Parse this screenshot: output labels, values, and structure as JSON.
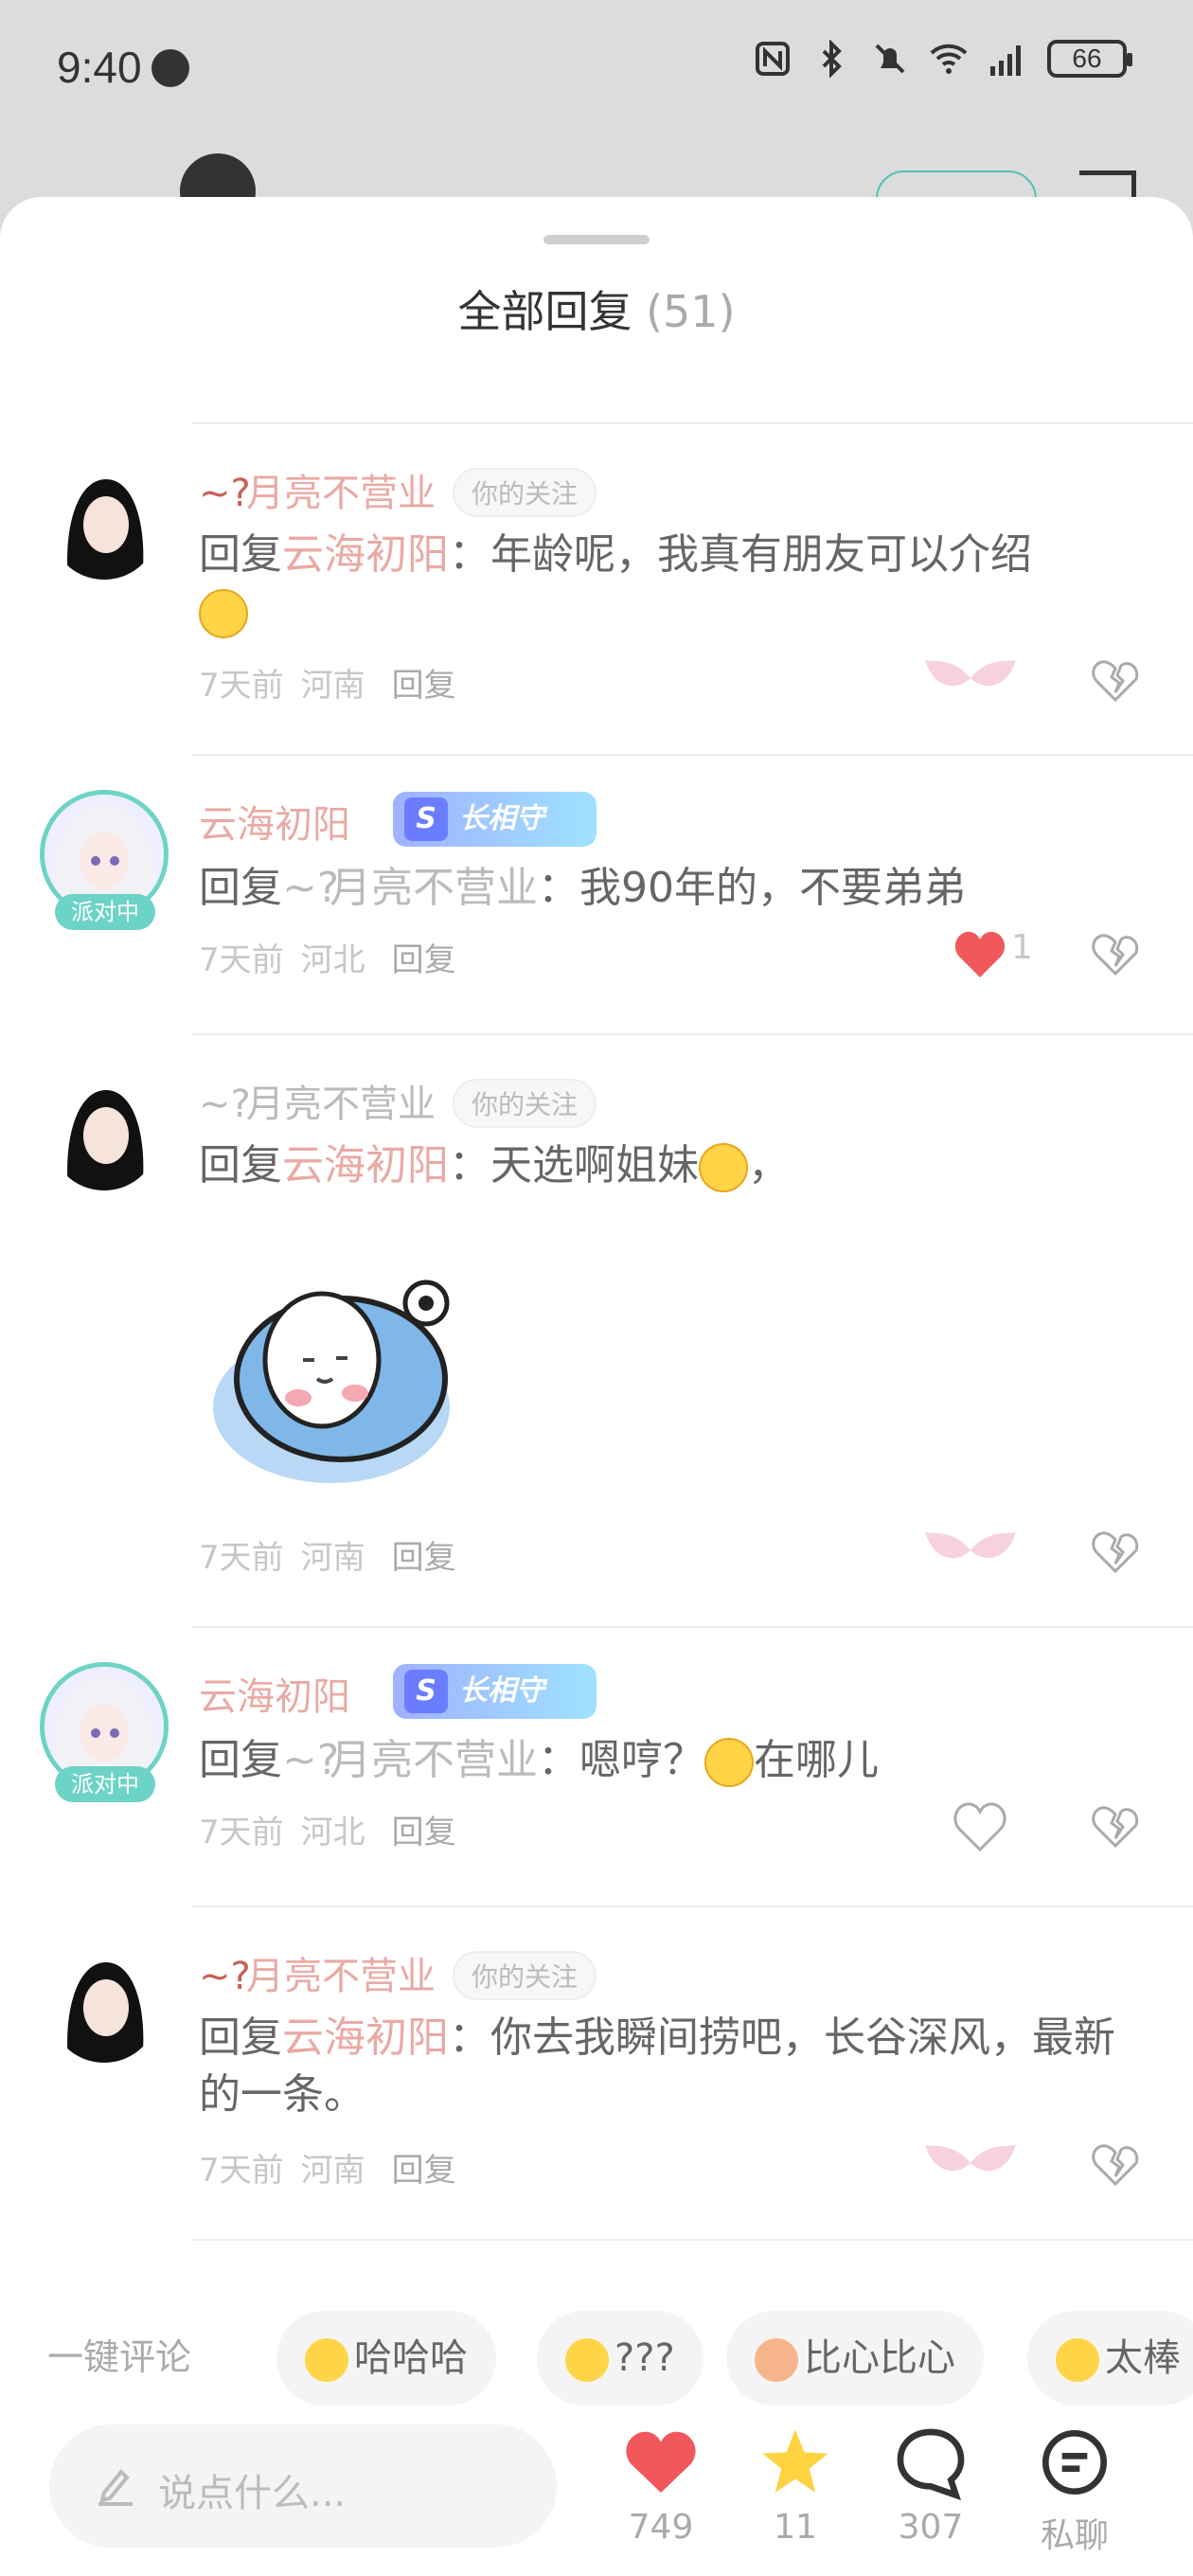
{
  "status_bar": {
    "time": "9:40",
    "battery": "66"
  },
  "sheet": {
    "title": "全部回复",
    "count": "(51)"
  },
  "comments": [
    {
      "username": "月亮不营业",
      "tag": "你的关注",
      "reply_prefix": "回复",
      "reply_to": "云海初阳",
      "text": "：年龄呢，我真有朋友可以介绍",
      "time": "7天前",
      "location": "河南",
      "reply_label": "回复",
      "like_count": ""
    },
    {
      "username": "云海初阳",
      "vip": "长相守",
      "live_badge": "派对中",
      "reply_prefix": "回复",
      "reply_to": "月亮不营业",
      "text": "：我90年的，不要弟弟",
      "time": "7天前",
      "location": "河北",
      "reply_label": "回复",
      "like_count": "1"
    },
    {
      "username": "月亮不营业",
      "tag": "你的关注",
      "reply_prefix": "回复",
      "reply_to": "云海初阳",
      "text": "：天选啊姐妹",
      "text_suffix": "，",
      "time": "7天前",
      "location": "河南",
      "reply_label": "回复",
      "like_count": ""
    },
    {
      "username": "云海初阳",
      "vip": "长相守",
      "live_badge": "派对中",
      "reply_prefix": "回复",
      "reply_to": "月亮不营业",
      "text": "：嗯哼？",
      "text_suffix": "在哪儿",
      "time": "7天前",
      "location": "河北",
      "reply_label": "回复",
      "like_count": ""
    },
    {
      "username": "月亮不营业",
      "tag": "你的关注",
      "reply_prefix": "回复",
      "reply_to": "云海初阳",
      "text": "：你去我瞬间捞吧，长谷深风，最新的一条。",
      "time": "7天前",
      "location": "河南",
      "reply_label": "回复",
      "like_count": ""
    }
  ],
  "quick_comments": {
    "label": "一键评论",
    "items": [
      "哈哈哈",
      "???",
      "比心比心",
      "太棒"
    ]
  },
  "bottom_bar": {
    "input_placeholder": "说点什么...",
    "likes": "749",
    "stars": "11",
    "comments": "307",
    "chat_label": "私聊"
  },
  "colors": {
    "accent_pink": "#e9aaa4",
    "teal": "#6dd3c6",
    "heart_red": "#f0585b",
    "star_yellow": "#ffd23f"
  }
}
